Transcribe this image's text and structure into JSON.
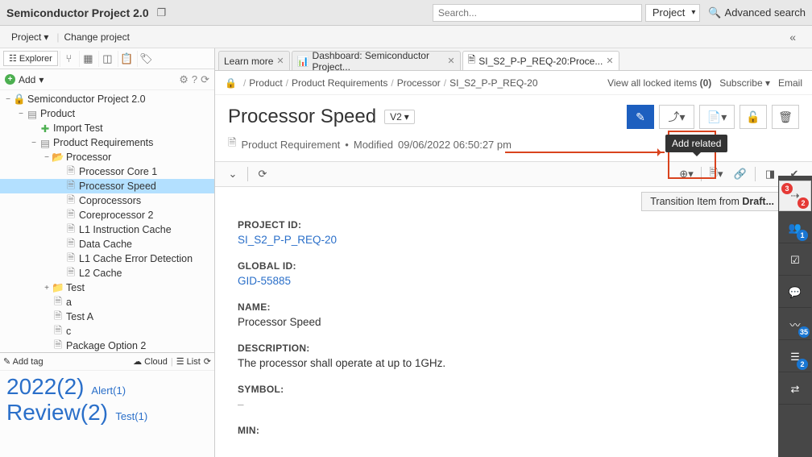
{
  "header": {
    "app_title": "Semiconductor Project 2.0",
    "search_placeholder": "Search...",
    "project_dropdown": "Project",
    "advanced_search": "Advanced search"
  },
  "subheader": {
    "project_menu": "Project",
    "change_project": "Change project"
  },
  "explorer": {
    "tab_label": "Explorer",
    "add_label": "Add",
    "tree": [
      {
        "depth": 0,
        "expander": "−",
        "iconClass": "project-ico",
        "icon": "🔒",
        "label": "Semiconductor Project 2.0"
      },
      {
        "depth": 1,
        "expander": "−",
        "iconClass": "doc-ico",
        "icon": "▤",
        "label": "Product"
      },
      {
        "depth": 2,
        "expander": "",
        "iconClass": "puzzle-ico",
        "icon": "✚",
        "label": "Import Test"
      },
      {
        "depth": 2,
        "expander": "−",
        "iconClass": "doc-ico",
        "icon": "▤",
        "label": "Product Requirements"
      },
      {
        "depth": 3,
        "expander": "−",
        "iconClass": "folder-ico",
        "icon": "📂",
        "label": "Processor"
      },
      {
        "depth": 4,
        "expander": "",
        "iconClass": "doc-ico",
        "icon": "🗎",
        "label": "Processor Core 1"
      },
      {
        "depth": 4,
        "expander": "",
        "iconClass": "doc-ico",
        "icon": "🗎",
        "label": "Processor Speed",
        "selected": true
      },
      {
        "depth": 4,
        "expander": "",
        "iconClass": "doc-ico",
        "icon": "🗎",
        "label": "Coprocessors"
      },
      {
        "depth": 4,
        "expander": "",
        "iconClass": "doc-ico",
        "icon": "🗎",
        "label": "Coreprocessor 2"
      },
      {
        "depth": 4,
        "expander": "",
        "iconClass": "doc-ico",
        "icon": "🗎",
        "label": "L1 Instruction Cache"
      },
      {
        "depth": 4,
        "expander": "",
        "iconClass": "doc-ico",
        "icon": "🗎",
        "label": "Data Cache"
      },
      {
        "depth": 4,
        "expander": "",
        "iconClass": "doc-ico",
        "icon": "🗎",
        "label": "L1 Cache Error Detection"
      },
      {
        "depth": 4,
        "expander": "",
        "iconClass": "doc-ico",
        "icon": "🗎",
        "label": "L2 Cache"
      },
      {
        "depth": 3,
        "expander": "+",
        "iconClass": "folder-ico",
        "icon": "📁",
        "label": "Test"
      },
      {
        "depth": 3,
        "expander": "",
        "iconClass": "doc-ico",
        "icon": "🗎",
        "label": "a"
      },
      {
        "depth": 3,
        "expander": "",
        "iconClass": "doc-ico",
        "icon": "🗎",
        "label": "Test A"
      },
      {
        "depth": 3,
        "expander": "",
        "iconClass": "doc-ico",
        "icon": "🗎",
        "label": "c"
      },
      {
        "depth": 3,
        "expander": "",
        "iconClass": "doc-ico",
        "icon": "🗎",
        "label": "Package Option 2"
      }
    ]
  },
  "tags": {
    "add_tag": "Add tag",
    "cloud": "Cloud",
    "list": "List",
    "items": [
      {
        "text": "2022(2)",
        "big": true
      },
      {
        "text": "Alert(1)",
        "big": false
      },
      {
        "text": "Review(2)",
        "big": true
      },
      {
        "text": "Test(1)",
        "big": false
      }
    ]
  },
  "tabs": [
    {
      "label": "Learn more",
      "icon": "",
      "active": false
    },
    {
      "label": "Dashboard: Semiconductor Project...",
      "icon": "📊",
      "active": false
    },
    {
      "label": "SI_S2_P-P_REQ-20:Proce...",
      "icon": "🗎",
      "active": true
    }
  ],
  "breadcrumb": {
    "parts": [
      "Product",
      "Product Requirements",
      "Processor",
      "SI_S2_P-P_REQ-20"
    ],
    "view_locked": "View all locked items",
    "locked_count": "(0)",
    "subscribe": "Subscribe",
    "email": "Email"
  },
  "item": {
    "title": "Processor Speed",
    "version": "V2",
    "type": "Product Requirement",
    "modified_label": "Modified",
    "modified": "09/06/2022 06:50:27 pm",
    "transition": "Transition Item from ",
    "transition_state": "Draft..."
  },
  "tooltip": {
    "add_related": "Add related"
  },
  "fields": [
    {
      "label": "PROJECT ID:",
      "value": "SI_S2_P-P_REQ-20",
      "link": true
    },
    {
      "label": "GLOBAL ID:",
      "value": "GID-55885",
      "link": true
    },
    {
      "label": "NAME:",
      "value": "Processor Speed"
    },
    {
      "label": "DESCRIPTION:",
      "value": "The processor shall operate at up to 1GHz."
    },
    {
      "label": "SYMBOL:",
      "value": "–",
      "dash": true
    },
    {
      "label": "MIN:",
      "value": ""
    }
  ],
  "rail_badges": {
    "top1": "3",
    "top2": "2",
    "people": "1",
    "bars": "35",
    "bottom": "2"
  }
}
